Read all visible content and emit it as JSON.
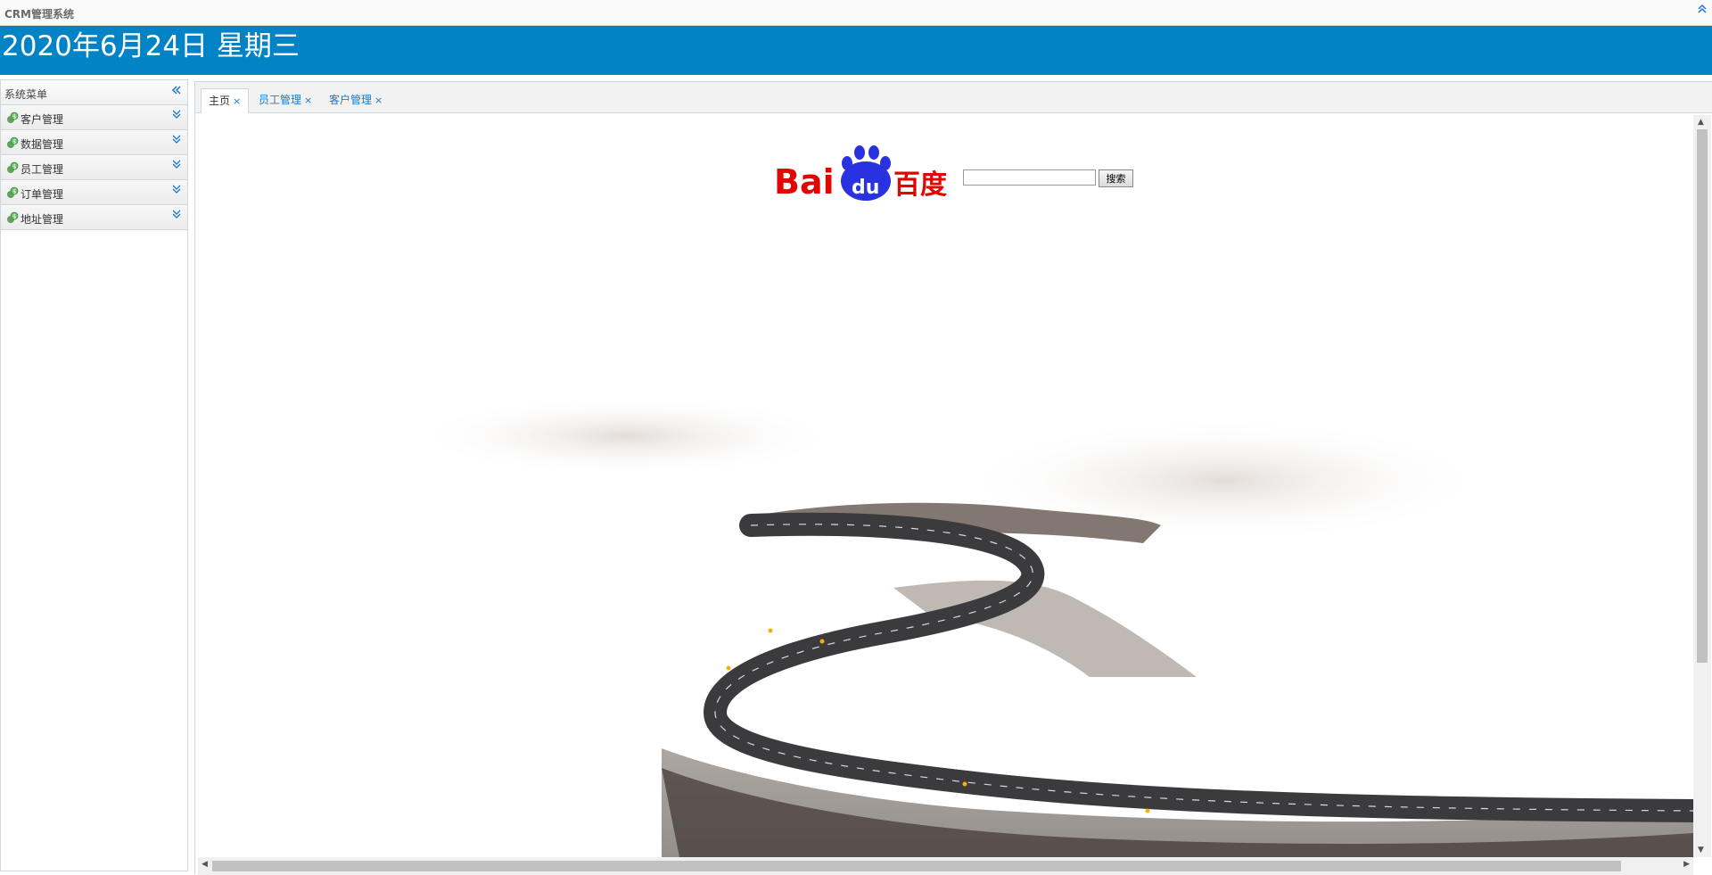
{
  "window": {
    "title": "CRM管理系统"
  },
  "banner": {
    "date_text": "2020年6月24日 星期三"
  },
  "sidebar": {
    "title": "系统菜单",
    "items": [
      {
        "label": "客户管理"
      },
      {
        "label": "数据管理"
      },
      {
        "label": "员工管理"
      },
      {
        "label": "订单管理"
      },
      {
        "label": "地址管理"
      }
    ]
  },
  "tabs": [
    {
      "label": "主页",
      "close": "×",
      "active": true
    },
    {
      "label": "员工管理",
      "close": "×",
      "active": false
    },
    {
      "label": "客户管理",
      "close": "×",
      "active": false
    }
  ],
  "search": {
    "logo_text_left": "Bai",
    "logo_text_paw": "du",
    "logo_text_right": "百度",
    "input_value": "",
    "button_label": "搜索"
  },
  "colors": {
    "banner": "#0183c6",
    "accent": "#1a79c8",
    "baidu_red": "#e10602",
    "baidu_blue": "#2932e1"
  },
  "icons": {
    "titlebar_collapse": "double-chevron-up-icon",
    "sidebar_collapse": "double-chevron-left-icon",
    "menu_item": "money-icon",
    "menu_expand": "double-chevron-down-icon"
  }
}
